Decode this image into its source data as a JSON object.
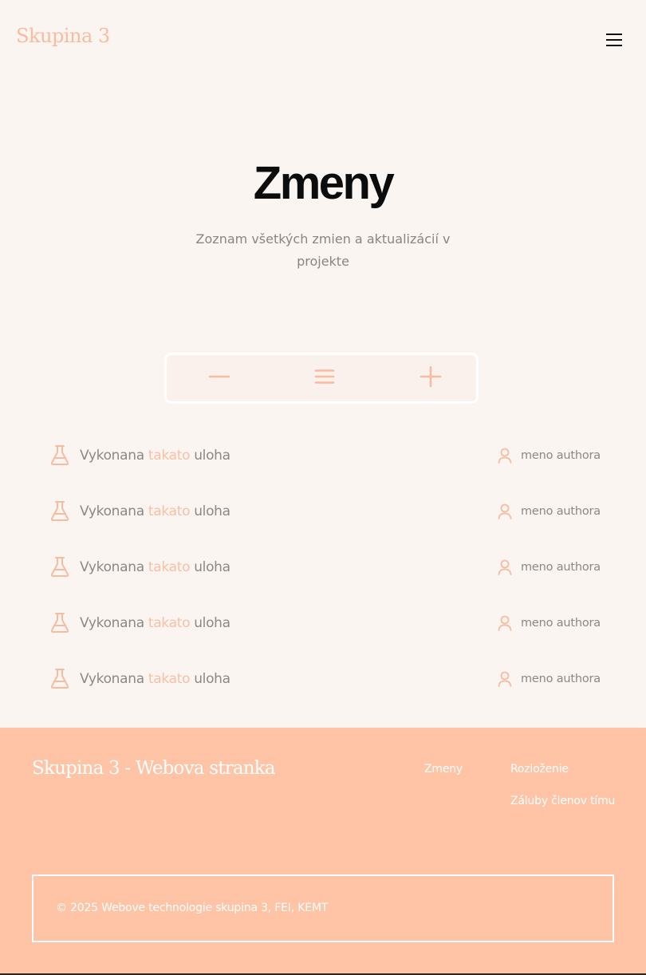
{
  "header": {
    "logo": "Skupina 3",
    "menu_icon": "hamburger-menu-icon"
  },
  "hero": {
    "title": "Zmeny",
    "subtitle": "Zoznam všetkých zmien a aktualizácií v projekte"
  },
  "controls": {
    "icons": [
      "minus-icon",
      "list-icon",
      "plus-icon"
    ]
  },
  "changes": [
    {
      "word1": "Vykonana",
      "word2": "takato",
      "word3": "uloha",
      "author": "meno authora"
    },
    {
      "word1": "Vykonana",
      "word2": "takato",
      "word3": "uloha",
      "author": "meno authora"
    },
    {
      "word1": "Vykonana",
      "word2": "takato",
      "word3": "uloha",
      "author": "meno authora"
    },
    {
      "word1": "Vykonana",
      "word2": "takato",
      "word3": "uloha",
      "author": "meno authora"
    },
    {
      "word1": "Vykonana",
      "word2": "takato",
      "word3": "uloha",
      "author": "meno authora"
    }
  ],
  "footer": {
    "title": "Skupina 3 - Webova stranka",
    "links": [
      "Zmeny",
      "Rozloženie",
      "Záluby členov tímu"
    ],
    "copyright": "© 2025 Webove technologie skupina 3, FEI, KEMT"
  },
  "colors": {
    "accent": "#f9bb9f",
    "background": "#faf5f1",
    "footer_background": "#ffc3a6",
    "text_muted": "#8c8884",
    "title": "#0c0c0c"
  }
}
